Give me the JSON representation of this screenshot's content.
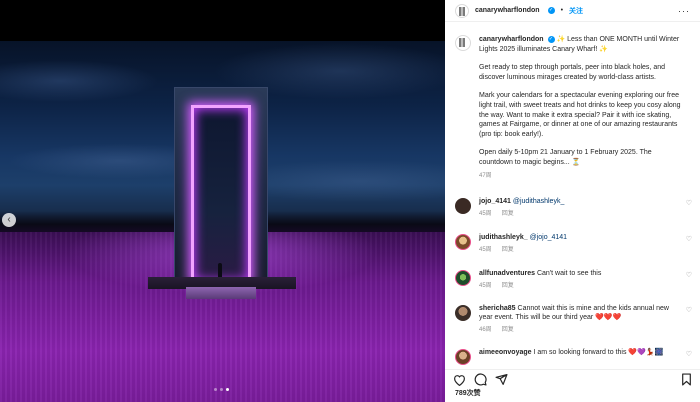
{
  "post": {
    "account": "canarywharflondon",
    "follow_label": "关注",
    "more_icon": "more-icon",
    "carousel": {
      "slide_count": 3,
      "active_slide": 3
    }
  },
  "caption": {
    "username": "canarywharflondon",
    "para1": "✨ Less than ONE MONTH until Winter Lights 2025 illuminates Canary Wharf! ✨",
    "para2": "Get ready to step through portals, peer into black holes, and discover luminous mirages created by world-class artists.",
    "para3": "Mark your calendars for a spectacular evening exploring our free light trail, with sweet treats and hot drinks to keep you cosy along the way. Want to make it extra special? Pair it with ice skating, games at Fairgame, or dinner at one of our amazing restaurants (pro tip: book early!).",
    "para4": "Open daily 5-10pm 21 January to 1 February 2025. The countdown to magic begins... ⏳",
    "age": "47周"
  },
  "comments": [
    {
      "user": "jojo_4141",
      "mention": "@judithashleyk_",
      "text": "",
      "age": "45周",
      "reply": "回复",
      "avatar_color": "#3a2a24"
    },
    {
      "user": "judithashleyk_",
      "mention": "@jojo_4141",
      "text": "",
      "age": "45周",
      "reply": "回复",
      "avatar_color": "#c99a6a"
    },
    {
      "user": "allfunadventures",
      "mention": "",
      "text": "Can't wait to see this",
      "age": "45周",
      "reply": "回复",
      "avatar_color": "#2f6b3a"
    },
    {
      "user": "shericha85",
      "mention": "",
      "text": "Cannot wait this is mine and the kids annual new year event. This will be our third year ❤️❤️❤️",
      "age": "46周",
      "reply": "回复",
      "avatar_color": "#4a3b35"
    },
    {
      "user": "aimeeonvoyage",
      "mention": "",
      "text": "I am so looking forward to this ❤️💜💃🏽🎆",
      "age": "",
      "reply": "",
      "avatar_color": "#8a5a3c"
    }
  ],
  "footer": {
    "likes": "789次赞"
  }
}
